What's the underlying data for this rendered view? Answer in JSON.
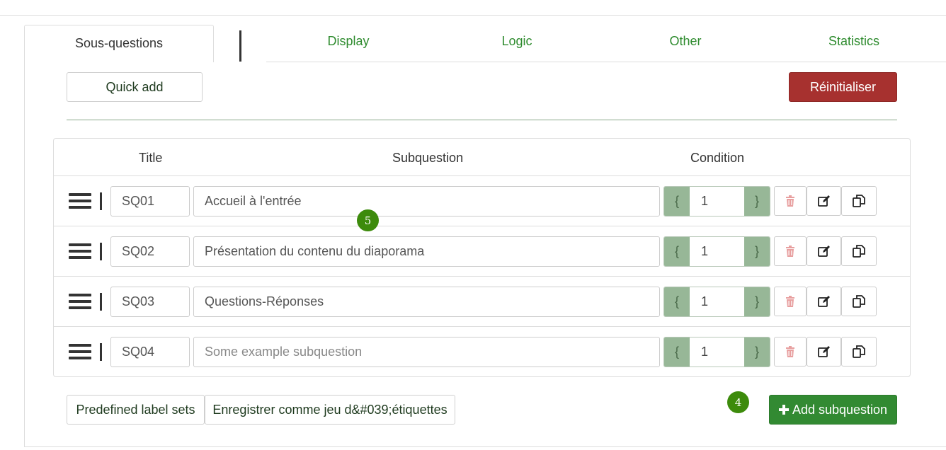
{
  "tabs": [
    {
      "label": "Sous-questions",
      "active": true
    },
    {
      "label": "Display"
    },
    {
      "label": "Logic"
    },
    {
      "label": "Other"
    },
    {
      "label": "Statistics"
    }
  ],
  "toolbar": {
    "quick_add_label": "Quick add",
    "reset_label": "Réinitialiser"
  },
  "table": {
    "headers": {
      "title": "Title",
      "subquestion": "Subquestion",
      "condition": "Condition"
    },
    "rows": [
      {
        "title": "SQ01",
        "subquestion": "Accueil à l'entrée",
        "condition": "1",
        "placeholder": false
      },
      {
        "title": "SQ02",
        "subquestion": "Présentation du contenu du diaporama",
        "condition": "1",
        "placeholder": false
      },
      {
        "title": "SQ03",
        "subquestion": "Questions-Réponses",
        "condition": "1",
        "placeholder": false
      },
      {
        "title": "SQ04",
        "subquestion": "Some example subquestion",
        "condition": "1",
        "placeholder": true
      }
    ],
    "brace_open": "{",
    "brace_close": "}"
  },
  "footer": {
    "predefined_label": "Predefined label sets",
    "save_label": "Enregistrer comme jeu d&#039;étiquettes",
    "add_label": "Add subquestion",
    "add_icon": "plus-icon"
  },
  "badges": {
    "tour_step_a": "5",
    "tour_step_b": "4"
  },
  "colors": {
    "link_green": "#2e8b2e",
    "reset_red": "#a7312f",
    "add_green": "#328a32",
    "condition_green": "#97b797",
    "delete_pink": "#e8a0a0",
    "badge_green": "#3d8b0c"
  }
}
